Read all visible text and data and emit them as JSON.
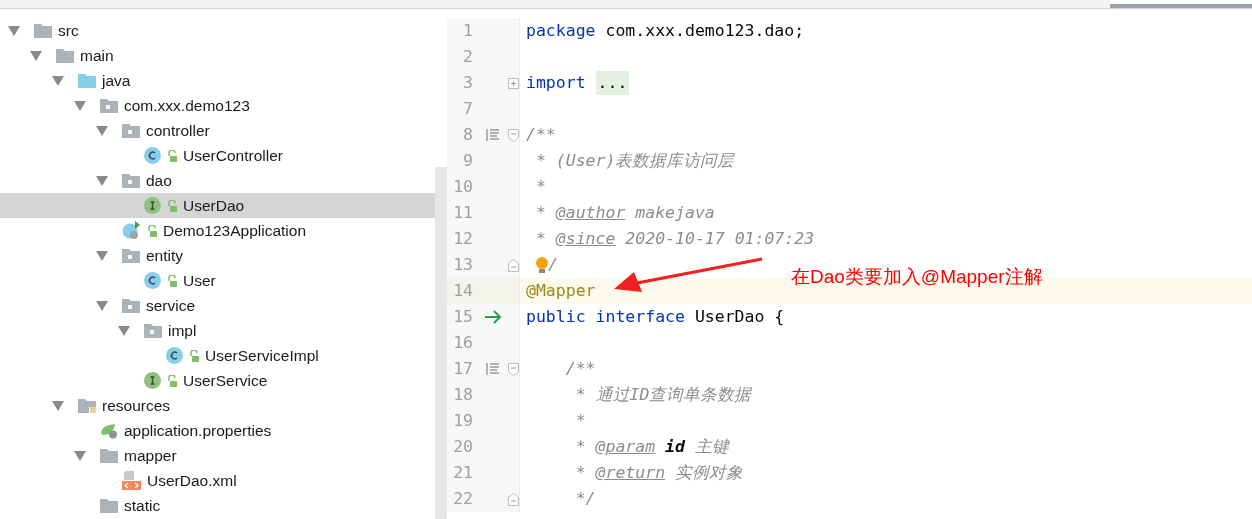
{
  "project_tree": {
    "items": [
      {
        "label": "src",
        "kind": "folder",
        "expanded": true,
        "selected": false,
        "children": [
          {
            "label": "main",
            "kind": "folder",
            "expanded": true,
            "selected": false,
            "children": [
              {
                "label": "java",
                "kind": "source-folder",
                "expanded": true,
                "selected": false,
                "children": [
                  {
                    "label": "com.xxx.demo123",
                    "kind": "package",
                    "expanded": true,
                    "selected": false,
                    "children": [
                      {
                        "label": "controller",
                        "kind": "package",
                        "expanded": true,
                        "selected": false,
                        "children": [
                          {
                            "label": "UserController",
                            "kind": "class",
                            "selected": false
                          }
                        ]
                      },
                      {
                        "label": "dao",
                        "kind": "package",
                        "expanded": true,
                        "selected": false,
                        "children": [
                          {
                            "label": "UserDao",
                            "kind": "interface",
                            "selected": true
                          }
                        ]
                      },
                      {
                        "label": "Demo123Application",
                        "kind": "spring-app",
                        "selected": false
                      },
                      {
                        "label": "entity",
                        "kind": "package",
                        "expanded": true,
                        "selected": false,
                        "children": [
                          {
                            "label": "User",
                            "kind": "class",
                            "selected": false
                          }
                        ]
                      },
                      {
                        "label": "service",
                        "kind": "package",
                        "expanded": true,
                        "selected": false,
                        "children": [
                          {
                            "label": "impl",
                            "kind": "package",
                            "expanded": true,
                            "selected": false,
                            "children": [
                              {
                                "label": "UserServiceImpl",
                                "kind": "class",
                                "selected": false
                              }
                            ]
                          },
                          {
                            "label": "UserService",
                            "kind": "interface",
                            "selected": false
                          }
                        ]
                      }
                    ]
                  }
                ]
              },
              {
                "label": "resources",
                "kind": "resources-folder",
                "expanded": true,
                "selected": false,
                "children": [
                  {
                    "label": "application.properties",
                    "kind": "properties",
                    "selected": false
                  },
                  {
                    "label": "mapper",
                    "kind": "folder",
                    "expanded": true,
                    "selected": false,
                    "children": [
                      {
                        "label": "UserDao.xml",
                        "kind": "xml",
                        "selected": false
                      }
                    ]
                  },
                  {
                    "label": "static",
                    "kind": "folder",
                    "selected": false
                  }
                ]
              }
            ]
          }
        ]
      }
    ]
  },
  "editor": {
    "lines": [
      {
        "number": "1",
        "current": false,
        "tokens": [
          {
            "kind": "keyword",
            "text": "package"
          },
          {
            "kind": "plain",
            "text": " com.xxx.demo123.dao;"
          }
        ]
      },
      {
        "number": "2",
        "current": false
      },
      {
        "number": "3",
        "current": false,
        "fold": {
          "kind": "collapsed"
        },
        "tokens": [
          {
            "kind": "keyword",
            "text": "import "
          },
          {
            "kind": "folded",
            "text": "..."
          }
        ]
      },
      {
        "number": "7",
        "current": false
      },
      {
        "number": "8",
        "current": false,
        "gutter_icon": {
          "kind": "doc-toggle"
        },
        "fold": {
          "kind": "start"
        },
        "tokens": [
          {
            "kind": "comment",
            "text": "/**"
          }
        ]
      },
      {
        "number": "9",
        "current": false,
        "tokens": [
          {
            "kind": "comment",
            "text": " * (User)表数据库访问层"
          }
        ]
      },
      {
        "number": "10",
        "current": false,
        "tokens": [
          {
            "kind": "comment",
            "text": " *"
          }
        ]
      },
      {
        "number": "11",
        "current": false,
        "tokens": [
          {
            "kind": "comment",
            "text": " * "
          },
          {
            "kind": "doc-tag",
            "text": "@author"
          },
          {
            "kind": "comment",
            "text": " makejava"
          }
        ]
      },
      {
        "number": "12",
        "current": false,
        "tokens": [
          {
            "kind": "comment",
            "text": " * "
          },
          {
            "kind": "doc-tag",
            "text": "@since"
          },
          {
            "kind": "comment",
            "text": " 2020-10-17 01:07:23"
          }
        ]
      },
      {
        "number": "13",
        "current": false,
        "fold": {
          "kind": "end"
        },
        "tokens": [
          {
            "kind": "bulb"
          },
          {
            "kind": "comment",
            "text": "/"
          }
        ]
      },
      {
        "number": "14",
        "current": true,
        "tokens": [
          {
            "kind": "annotation",
            "text": "@Mapper"
          }
        ]
      },
      {
        "number": "15",
        "current": false,
        "gutter_icon": {
          "kind": "implementation-arrow"
        },
        "tokens": [
          {
            "kind": "keyword",
            "text": "public interface"
          },
          {
            "kind": "plain",
            "text": " UserDao {"
          }
        ]
      },
      {
        "number": "16",
        "current": false
      },
      {
        "number": "17",
        "current": false,
        "gutter_icon": {
          "kind": "doc-toggle"
        },
        "fold": {
          "kind": "start"
        },
        "tokens": [
          {
            "kind": "comment",
            "text": "    /**"
          }
        ]
      },
      {
        "number": "18",
        "current": false,
        "tokens": [
          {
            "kind": "comment",
            "text": "     * 通过ID查询单条数据"
          }
        ]
      },
      {
        "number": "19",
        "current": false,
        "tokens": [
          {
            "kind": "comment",
            "text": "     *"
          }
        ]
      },
      {
        "number": "20",
        "current": false,
        "tokens": [
          {
            "kind": "comment",
            "text": "     * "
          },
          {
            "kind": "doc-tag",
            "text": "@param"
          },
          {
            "kind": "param",
            "text": " id"
          },
          {
            "kind": "comment",
            "text": " 主键"
          }
        ]
      },
      {
        "number": "21",
        "current": false,
        "tokens": [
          {
            "kind": "comment",
            "text": "     * "
          },
          {
            "kind": "doc-tag",
            "text": "@return"
          },
          {
            "kind": "comment",
            "text": " 实例对象"
          }
        ]
      },
      {
        "number": "22",
        "current": false,
        "fold": {
          "kind": "end"
        },
        "tokens": [
          {
            "kind": "comment",
            "text": "     */"
          }
        ]
      }
    ]
  },
  "annotation": {
    "text": "在Dao类要加入@Mapper注解"
  }
}
